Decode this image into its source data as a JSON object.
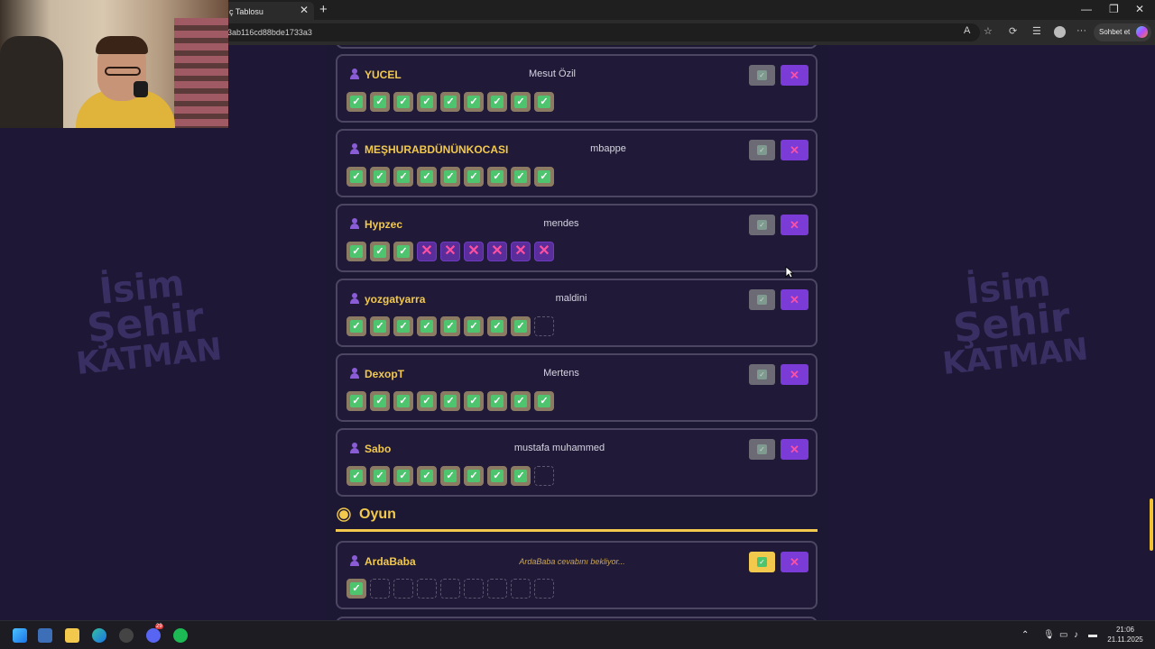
{
  "browser": {
    "tab_title": "ç Tablosu",
    "url_fragment": "3ab116cd88bde1733a3",
    "chat_button": "Sohbet et"
  },
  "players": [
    {
      "name": "YUCEL",
      "answer": "Mesut Özil",
      "boxes": [
        "ok",
        "ok",
        "ok",
        "ok",
        "ok",
        "ok",
        "ok",
        "ok",
        "ok"
      ]
    },
    {
      "name": "MEŞHURABDÜNÜNKOCASI",
      "answer": "mbappe",
      "boxes": [
        "ok",
        "ok",
        "ok",
        "ok",
        "ok",
        "ok",
        "ok",
        "ok",
        "ok"
      ]
    },
    {
      "name": "Hypzec",
      "answer": "mendes",
      "boxes": [
        "ok",
        "ok",
        "ok",
        "no",
        "no",
        "no",
        "no",
        "no",
        "no"
      ]
    },
    {
      "name": "yozgatyarra",
      "answer": "maldini",
      "boxes": [
        "ok",
        "ok",
        "ok",
        "ok",
        "ok",
        "ok",
        "ok",
        "ok",
        "empty"
      ]
    },
    {
      "name": "DexopT",
      "answer": "Mertens",
      "boxes": [
        "ok",
        "ok",
        "ok",
        "ok",
        "ok",
        "ok",
        "ok",
        "ok",
        "ok"
      ]
    },
    {
      "name": "Sabo",
      "answer": "mustafa muhammed",
      "boxes": [
        "ok",
        "ok",
        "ok",
        "ok",
        "ok",
        "ok",
        "ok",
        "ok",
        "empty"
      ]
    }
  ],
  "section": {
    "title": "Oyun"
  },
  "game_player": {
    "name": "ArdaBaba",
    "status": "ArdaBaba cevabını bekliyor...",
    "boxes": [
      "ok",
      "empty",
      "empty",
      "empty",
      "empty",
      "empty",
      "empty",
      "empty",
      "empty"
    ]
  },
  "background_logo": {
    "line1": "İsim",
    "line2": "Şehir",
    "line3": "KATMAN"
  },
  "icons": {
    "check": "✓",
    "cross": "✕"
  },
  "colors": {
    "accent": "#f2c94c",
    "purple": "#7a3bd6",
    "correct": "#4ec46f",
    "wrong": "#ff4fa0"
  },
  "taskbar": {
    "time": "21:06",
    "date": "21.11.2025",
    "discord_badge": "29"
  }
}
